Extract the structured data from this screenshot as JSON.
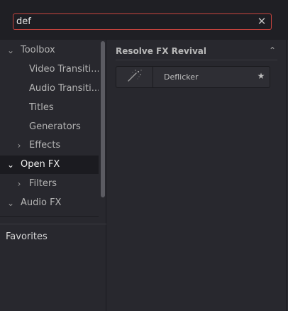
{
  "search": {
    "value": "def",
    "clear_glyph": "✕"
  },
  "tree": {
    "items": [
      {
        "label": "Toolbox",
        "chevron": "⌄"
      },
      {
        "label": "Video Transiti..."
      },
      {
        "label": "Audio Transiti..."
      },
      {
        "label": "Titles"
      },
      {
        "label": "Generators"
      },
      {
        "label": "Effects",
        "chevron": "›"
      },
      {
        "label": "Open FX",
        "chevron": "⌄"
      },
      {
        "label": "Filters",
        "chevron": "›"
      },
      {
        "label": "Audio FX",
        "chevron": "⌄"
      }
    ]
  },
  "favorites": {
    "label": "Favorites"
  },
  "group": {
    "title": "Resolve FX Revival",
    "collapse_glyph": "⌃"
  },
  "effects": [
    {
      "name": "Deflicker",
      "icon": "magic-wand-icon",
      "star_glyph": "★"
    }
  ],
  "colors": {
    "search_border": "#c8443e",
    "selected_row": "#1b1b20",
    "panel_bg": "#28282e"
  }
}
